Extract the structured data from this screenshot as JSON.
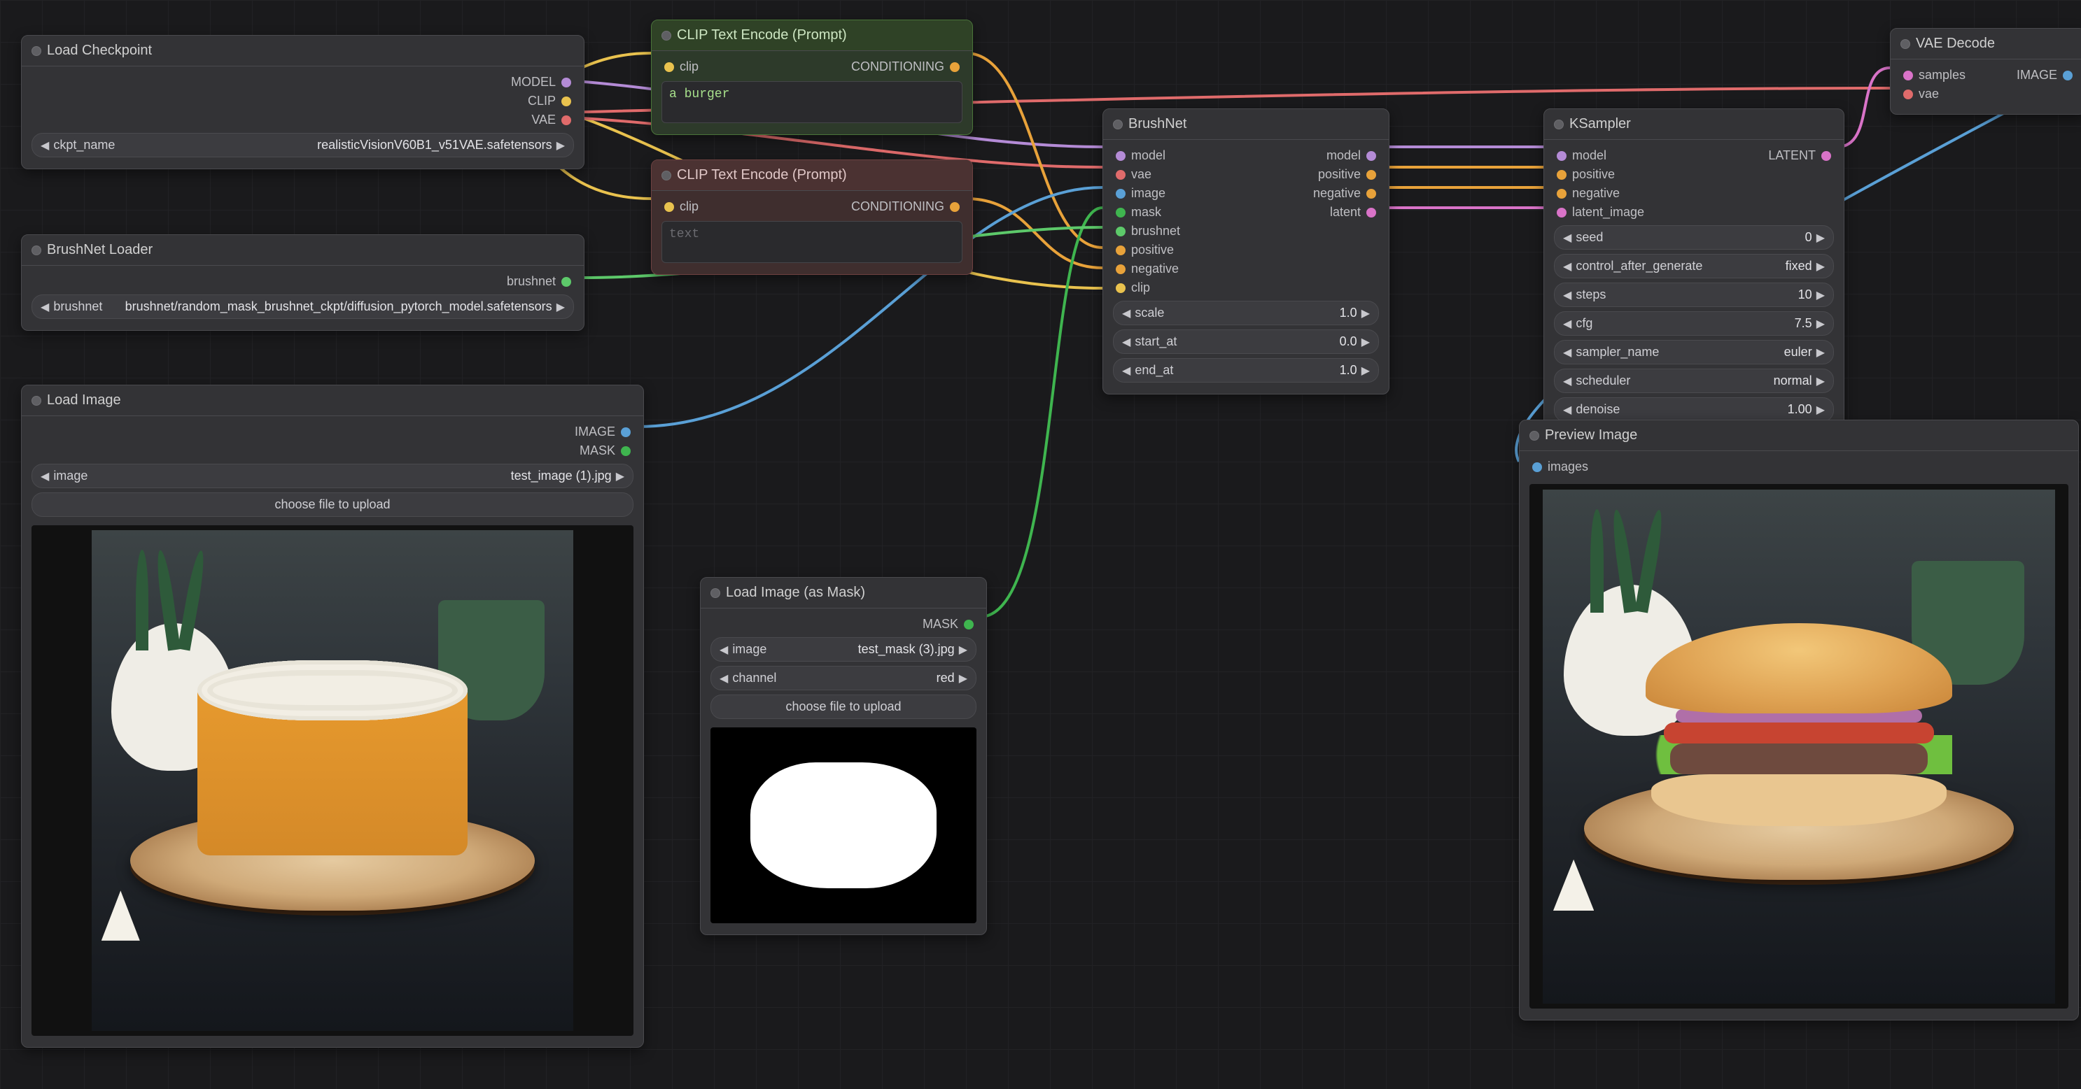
{
  "nodes": {
    "load_checkpoint": {
      "title": "Load Checkpoint",
      "outputs": {
        "model": "MODEL",
        "clip": "CLIP",
        "vae": "VAE"
      },
      "widget": {
        "label": "ckpt_name",
        "value": "realisticVisionV60B1_v51VAE.safetensors"
      }
    },
    "brushnet_loader": {
      "title": "BrushNet Loader",
      "outputs": {
        "brushnet": "brushnet"
      },
      "widget": {
        "label": "brushnet",
        "value": "brushnet/random_mask_brushnet_ckpt/diffusion_pytorch_model.safetensors"
      }
    },
    "load_image": {
      "title": "Load Image",
      "outputs": {
        "image": "IMAGE",
        "mask": "MASK"
      },
      "widget": {
        "label": "image",
        "value": "test_image (1).jpg"
      },
      "upload": "choose file to upload"
    },
    "clip_pos": {
      "title": "CLIP Text Encode (Prompt)",
      "inputs": {
        "clip": "clip"
      },
      "outputs": {
        "conditioning": "CONDITIONING"
      },
      "text": "a burger"
    },
    "clip_neg": {
      "title": "CLIP Text Encode (Prompt)",
      "inputs": {
        "clip": "clip"
      },
      "outputs": {
        "conditioning": "CONDITIONING"
      },
      "placeholder": "text"
    },
    "load_mask": {
      "title": "Load Image (as Mask)",
      "outputs": {
        "mask": "MASK"
      },
      "widgets": {
        "image": {
          "label": "image",
          "value": "test_mask (3).jpg"
        },
        "channel": {
          "label": "channel",
          "value": "red"
        }
      },
      "upload": "choose file to upload"
    },
    "brushnet": {
      "title": "BrushNet",
      "inputs": {
        "model": "model",
        "vae": "vae",
        "image": "image",
        "mask": "mask",
        "brushnet": "brushnet",
        "positive": "positive",
        "negative": "negative",
        "clip": "clip"
      },
      "outputs": {
        "model": "model",
        "positive": "positive",
        "negative": "negative",
        "latent": "latent"
      },
      "widgets": {
        "scale": {
          "label": "scale",
          "value": "1.0"
        },
        "start_at": {
          "label": "start_at",
          "value": "0.0"
        },
        "end_at": {
          "label": "end_at",
          "value": "1.0"
        }
      }
    },
    "ksampler": {
      "title": "KSampler",
      "inputs": {
        "model": "model",
        "positive": "positive",
        "negative": "negative",
        "latent_image": "latent_image"
      },
      "outputs": {
        "latent": "LATENT"
      },
      "widgets": {
        "seed": {
          "label": "seed",
          "value": "0"
        },
        "control_after_generate": {
          "label": "control_after_generate",
          "value": "fixed"
        },
        "steps": {
          "label": "steps",
          "value": "10"
        },
        "cfg": {
          "label": "cfg",
          "value": "7.5"
        },
        "sampler_name": {
          "label": "sampler_name",
          "value": "euler"
        },
        "scheduler": {
          "label": "scheduler",
          "value": "normal"
        },
        "denoise": {
          "label": "denoise",
          "value": "1.00"
        }
      }
    },
    "vae_decode": {
      "title": "VAE Decode",
      "inputs": {
        "samples": "samples",
        "vae": "vae"
      },
      "outputs": {
        "image": "IMAGE"
      }
    },
    "preview": {
      "title": "Preview Image",
      "inputs": {
        "images": "images"
      }
    }
  }
}
